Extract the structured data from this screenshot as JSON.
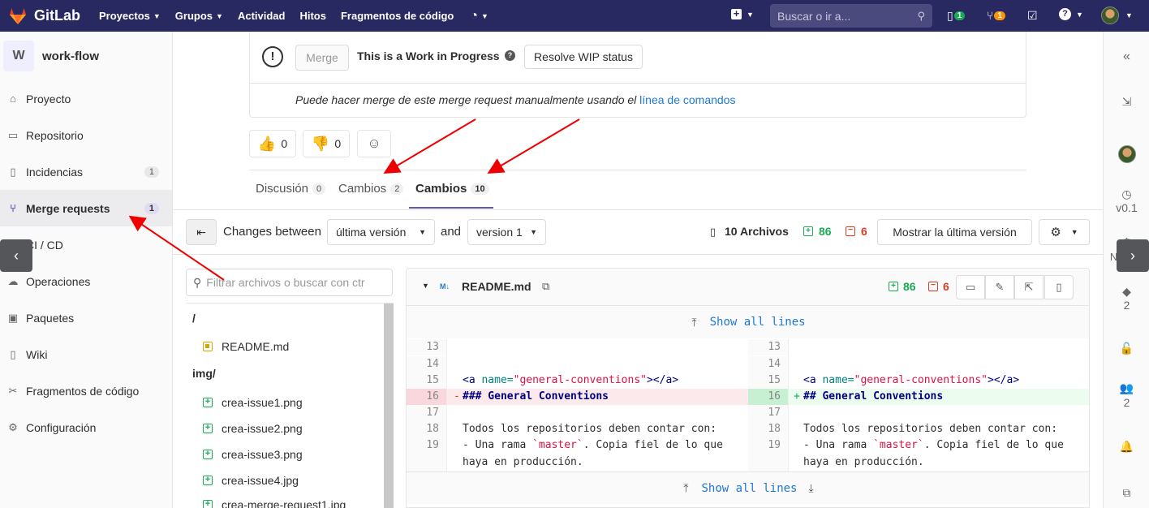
{
  "topbar": {
    "brand": "GitLab",
    "nav": [
      "Proyectos",
      "Grupos",
      "Actividad",
      "Hitos",
      "Fragmentos de código"
    ],
    "search_placeholder": "Buscar o ir a...",
    "issues_count": "1",
    "mr_count": "1"
  },
  "sidebar": {
    "project_initial": "W",
    "project_name": "work-flow",
    "items": [
      {
        "label": "Proyecto",
        "icon": "home-icon"
      },
      {
        "label": "Repositorio",
        "icon": "doc-icon"
      },
      {
        "label": "Incidencias",
        "icon": "issues-icon",
        "count": "1"
      },
      {
        "label": "Merge requests",
        "icon": "merge-icon",
        "count": "1"
      },
      {
        "label": "CI / CD",
        "icon": "rocket-icon"
      },
      {
        "label": "Operaciones",
        "icon": "cloud-icon"
      },
      {
        "label": "Paquetes",
        "icon": "package-icon"
      },
      {
        "label": "Wiki",
        "icon": "book-icon"
      },
      {
        "label": "Fragmentos de código",
        "icon": "snippet-icon"
      },
      {
        "label": "Configuración",
        "icon": "settings-icon"
      }
    ]
  },
  "widget": {
    "merge_label": "Merge",
    "wip_text": "This is a Work in Progress",
    "resolve_label": "Resolve WIP status",
    "manual_text": "Puede hacer merge de este merge request manualmente usando el",
    "cmd_link": "línea de comandos"
  },
  "emoji": {
    "thumbsup": "0",
    "thumbsdown": "0"
  },
  "tabs": [
    {
      "label": "Discusión",
      "count": "0"
    },
    {
      "label": "Cambios",
      "count": "2"
    },
    {
      "label": "Cambios",
      "count": "10"
    }
  ],
  "changes_bar": {
    "between_label": "Changes between",
    "version_a": "última versión",
    "and_label": "and",
    "version_b": "version 1",
    "files_label": "10 Archivos",
    "added": "86",
    "removed": "6",
    "show_latest": "Mostrar la última versión"
  },
  "filetree": {
    "filter_placeholder": "Filtrar archivos o buscar con ctr",
    "root": "/",
    "readme": "README.md",
    "img_dir": "img/",
    "files": [
      "crea-issue1.png",
      "crea-issue2.png",
      "crea-issue3.png",
      "crea-issue4.jpg",
      "crea-merge-request1.jpg"
    ]
  },
  "diff": {
    "file_name": "README.md",
    "added": "86",
    "removed": "6",
    "show_all": "Show all lines",
    "line_nums": [
      "13",
      "14",
      "15",
      "16",
      "17",
      "18",
      "19"
    ],
    "anchor_tag_open": "<a ",
    "anchor_attr": "name=",
    "anchor_value": "\"general-conventions\"",
    "anchor_tag_close": "></a>",
    "heading": "### General Conventions",
    "heading_new": "## General Conventions",
    "line18": "Todos los repositorios deben contar con:",
    "line19_a": "- Una rama ",
    "line19_code": "`master`",
    "line19_b": ". Copia fiel de lo que",
    "line19_wrap": "haya en producción."
  },
  "rsidebar": {
    "version": "v0.1",
    "milestone": "Ningun",
    "labels_count": "2",
    "participants_count": "2"
  },
  "colors": {
    "topbar": "#292961",
    "accent": "#6b4fbb",
    "link": "#1f78d1",
    "added": "#1aaa55",
    "removed": "#db3b21"
  }
}
